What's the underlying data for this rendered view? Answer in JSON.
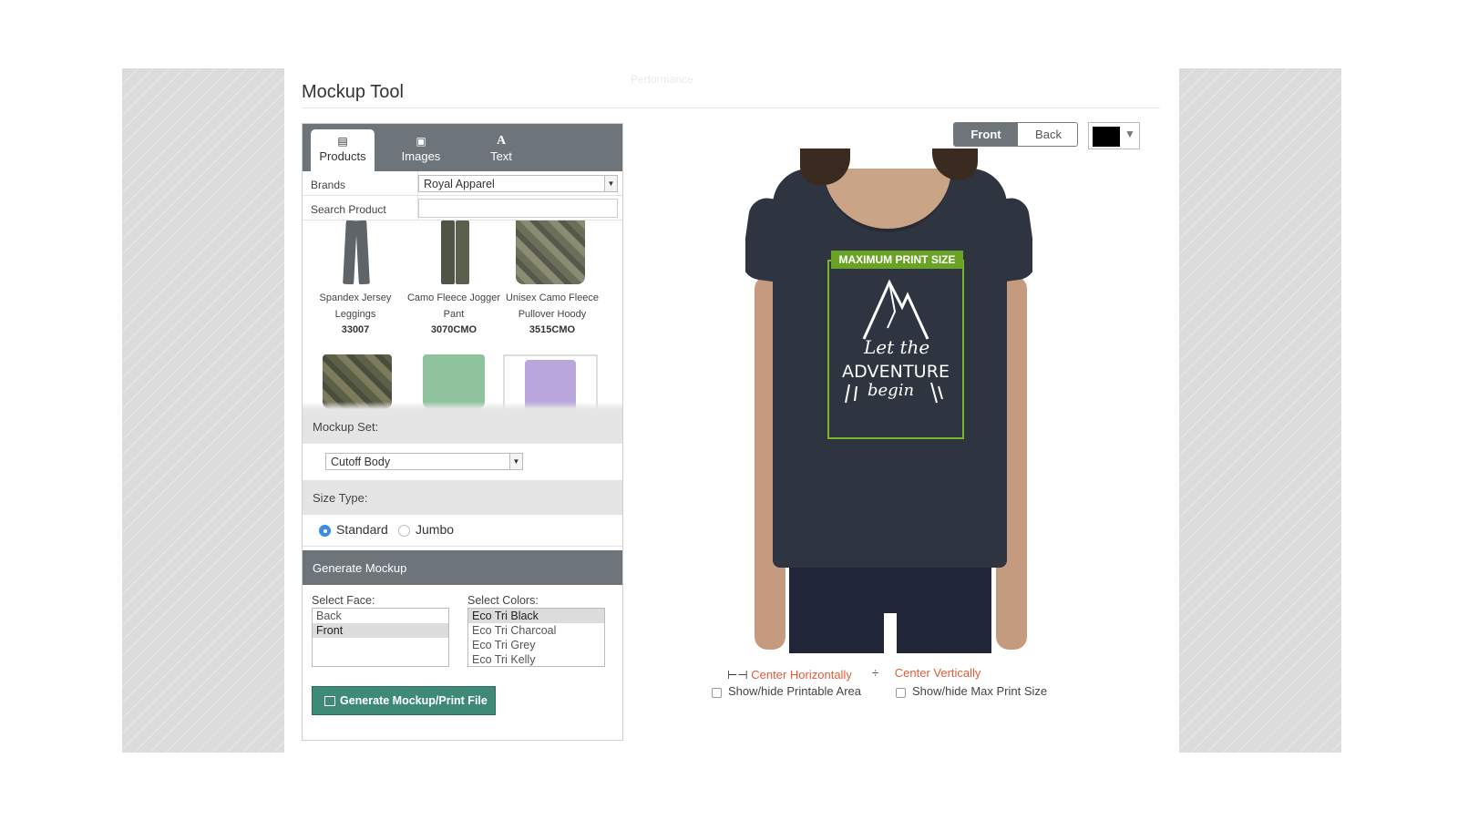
{
  "page": {
    "title": "Mockup Tool",
    "ghost_text": "Performance"
  },
  "tabs": [
    {
      "label": "Products",
      "icon": "list-icon"
    },
    {
      "label": "Images",
      "icon": "image-icon"
    },
    {
      "label": "Text",
      "icon": "text-a-icon"
    }
  ],
  "filters": {
    "brands_label": "Brands",
    "brands_value": "Royal Apparel",
    "search_label": "Search Product",
    "search_value": ""
  },
  "products": [
    {
      "name1": "Spandex Jersey",
      "name2": "Leggings",
      "sku": "33007"
    },
    {
      "name1": "Camo Fleece Jogger",
      "name2": "Pant",
      "sku": "3070CMO"
    },
    {
      "name1": "Unisex Camo Fleece",
      "name2": "Pullover Hoody",
      "sku": "3515CMO"
    }
  ],
  "mockup_set": {
    "label": "Mockup Set:",
    "value": "Cutoff Body"
  },
  "size_type": {
    "label": "Size Type:",
    "options": [
      "Standard",
      "Jumbo"
    ],
    "selected": "Standard"
  },
  "generate": {
    "header": "Generate Mockup",
    "face_label": "Select Face:",
    "faces": [
      "Back",
      "Front"
    ],
    "selected_face": "Front",
    "colors_label": "Select Colors:",
    "colors": [
      "Eco Tri Black",
      "Eco Tri Charcoal",
      "Eco Tri Grey",
      "Eco Tri Kelly"
    ],
    "selected_color": "Eco Tri Black",
    "button_label": "Generate Mockup/Print File"
  },
  "view": {
    "front_label": "Front",
    "back_label": "Back",
    "active": "Front",
    "swatch_color": "#000000"
  },
  "canvas": {
    "print_area_label": "MAXIMUM PRINT SIZE",
    "design_text": [
      "Let the",
      "ADVENTURE",
      "begin"
    ]
  },
  "controls": {
    "center_h": "Center Horizontally",
    "center_v": "Center Vertically",
    "show_printable": "Show/hide Printable Area",
    "show_max": "Show/hide Max Print Size"
  },
  "colors": {
    "tab_bar": "#6d757b",
    "generate_button": "#3f8a77",
    "print_area": "#7ab52d",
    "link": "#e35b3a"
  }
}
